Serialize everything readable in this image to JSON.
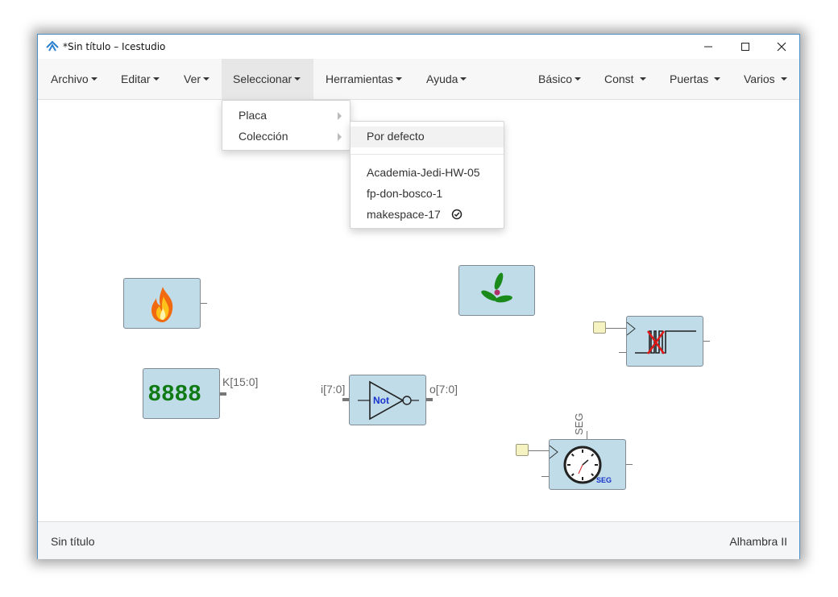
{
  "window": {
    "title": "*Sin título – Icestudio",
    "buttons": {
      "minimize": "—",
      "maximize": "☐",
      "close": "✕"
    }
  },
  "menubar": {
    "left": [
      {
        "label": "Archivo"
      },
      {
        "label": "Editar"
      },
      {
        "label": "Ver"
      },
      {
        "label": "Seleccionar"
      },
      {
        "label": "Herramientas"
      },
      {
        "label": "Ayuda"
      }
    ],
    "right": [
      {
        "label": "Básico"
      },
      {
        "label": "Const"
      },
      {
        "label": "Puertas"
      },
      {
        "label": "Varios"
      }
    ]
  },
  "select_menu": {
    "items": [
      "Placa",
      "Colección"
    ]
  },
  "collection_menu": {
    "items": [
      "Por defecto",
      "Academia-Jedi-HW-05",
      "fp-don-bosco-1",
      "makespace-17"
    ],
    "checked": "makespace-17"
  },
  "blocks": {
    "display_text": "8888",
    "display_output": "K[15:0]",
    "not_input": "i[7:0]",
    "not_output": "o[7:0]",
    "not_text": "Not",
    "timer_top": "SEG",
    "timer_badge": "SEG"
  },
  "footer": {
    "left": "Sin título",
    "right": "Alhambra II"
  },
  "colors": {
    "block_fill": "#bfdce8",
    "display_green": "#0f7a14",
    "not_blue": "#1a33cc",
    "window_border": "#4a8fc6"
  }
}
